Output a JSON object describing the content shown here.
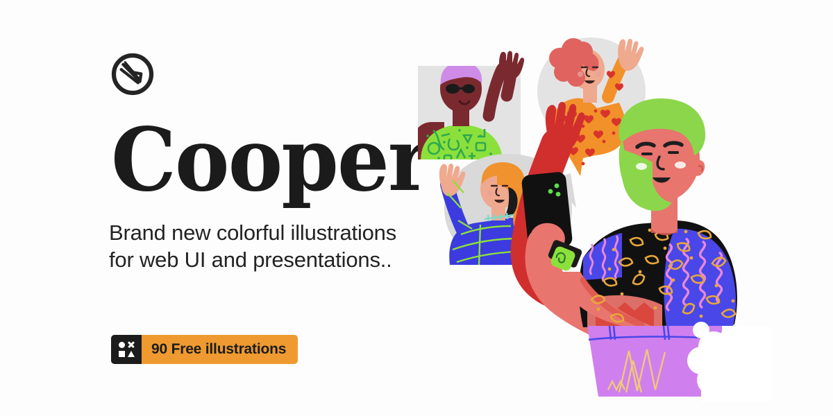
{
  "background_color": "#FDFDFD",
  "brand": {
    "logo_icon": "pen-nib-in-circle-icon",
    "title": "Cooper"
  },
  "hero": {
    "tagline": "Brand new colorful illustrations for web UI and presentations..",
    "badge": {
      "label": "90 Free illustrations",
      "count": 90,
      "icon": "shapes-grid-icon",
      "icon_shapes": [
        "circle",
        "cross",
        "square",
        "triangle"
      ],
      "background_color": "#EF9A30",
      "icon_background_color": "#1C1C1C",
      "text_color": "#1C1C1C"
    }
  },
  "colors": {
    "ink": "#1B1B1B",
    "body_text": "#232323",
    "accent_orange": "#EF9A30",
    "bubble_gray": "#E3E3E3",
    "bubble_gray_light": "#D9D9D9",
    "green_hair": "#8BD64B",
    "skin_pink": "#E8756E",
    "sleeve_red": "#D12E2E",
    "shirt_black": "#111111",
    "leaf_gold": "#E8A73C",
    "shoulder_blue": "#4A47E8",
    "wave_pink": "#E889D6",
    "skirt_purple": "#D07FEE",
    "orange_shirt": "#F2912A",
    "heart_red": "#D9342B",
    "hair_coral": "#E0635F",
    "blue_sweater": "#3B3BE0",
    "hair_blonde": "#F0922E",
    "green_tee": "#8CE03C",
    "skin_dark": "#7A2A2F",
    "hair_lilac": "#CE8CE8"
  },
  "illustration": {
    "name": "cooper-people-illustration",
    "characters": [
      {
        "id": "character-sunglasses",
        "hair": "lilac",
        "accessory": "sunglasses",
        "top": "green patterned t-shirt",
        "bubble": "rectangle",
        "pose": "waving"
      },
      {
        "id": "character-curly-hair",
        "hair": "coral curly",
        "top": "orange heart-pattern shirt",
        "bubble": "circle",
        "pose": "waving"
      },
      {
        "id": "character-long-hair",
        "hair": "blonde long",
        "top": "blue sweater",
        "bubble": "rounded-blob",
        "pose": "waving"
      },
      {
        "id": "character-main-phone",
        "hair": "green",
        "beard": "green",
        "top": "black leaf-pattern sweater with blue shoulder",
        "bottom": "purple skirt",
        "holding": "smartphone",
        "wearing": "smartwatch",
        "pose": "holding phone, arm raised"
      }
    ]
  }
}
